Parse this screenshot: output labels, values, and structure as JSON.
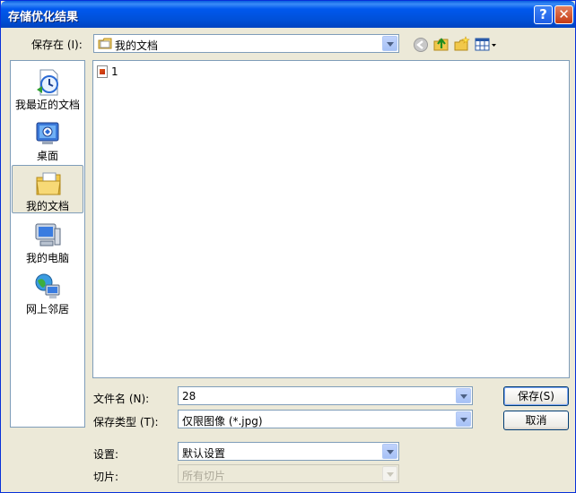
{
  "window": {
    "title": "存储优化结果",
    "help_label": "?",
    "close_label": "✕"
  },
  "save_in": {
    "label": "保存在 (I):",
    "value": "我的文档"
  },
  "toolbar": {
    "icons": [
      "back-icon",
      "up-folder-icon",
      "new-folder-icon",
      "view-menu-icon"
    ]
  },
  "places": [
    {
      "label": "我最近的文档",
      "icon": "recent-documents-icon"
    },
    {
      "label": "桌面",
      "icon": "desktop-icon"
    },
    {
      "label": "我的文档",
      "icon": "my-documents-icon",
      "selected": true
    },
    {
      "label": "我的电脑",
      "icon": "my-computer-icon"
    },
    {
      "label": "网上邻居",
      "icon": "network-places-icon"
    }
  ],
  "files": [
    {
      "name": "1"
    }
  ],
  "file_name": {
    "label": "文件名 (N):",
    "value": "28"
  },
  "save_type": {
    "label": "保存类型 (T):",
    "value": "仅限图像 (*.jpg)"
  },
  "settings": {
    "label": "设置:",
    "value": "默认设置"
  },
  "slices": {
    "label": "切片:",
    "value": "所有切片"
  },
  "buttons": {
    "save": "保存(S)",
    "cancel": "取消"
  }
}
